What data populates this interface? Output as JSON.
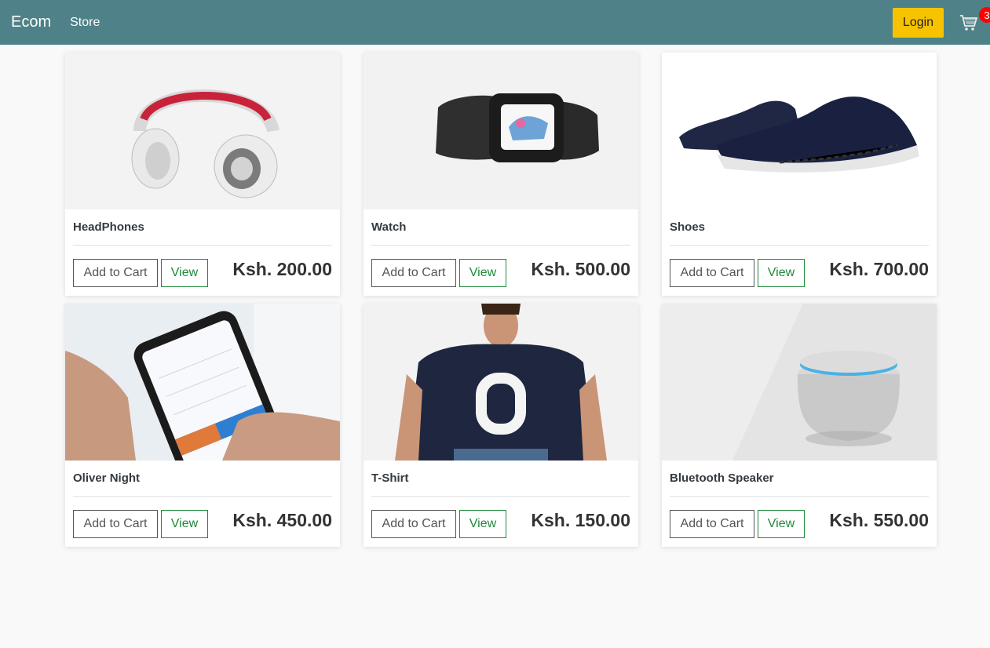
{
  "nav": {
    "brand": "Ecom",
    "store_label": "Store",
    "login_label": "Login",
    "cart_count": "3"
  },
  "products": [
    {
      "name": "HeadPhones",
      "price": "Ksh. 200.00",
      "add_label": "Add to Cart",
      "view_label": "View",
      "image": "headphones"
    },
    {
      "name": "Watch",
      "price": "Ksh. 500.00",
      "add_label": "Add to Cart",
      "view_label": "View",
      "image": "watch"
    },
    {
      "name": "Shoes",
      "price": "Ksh. 700.00",
      "add_label": "Add to Cart",
      "view_label": "View",
      "image": "shoes"
    },
    {
      "name": "Oliver Night",
      "price": "Ksh. 450.00",
      "add_label": "Add to Cart",
      "view_label": "View",
      "image": "phone"
    },
    {
      "name": "T-Shirt",
      "price": "Ksh. 150.00",
      "add_label": "Add to Cart",
      "view_label": "View",
      "image": "tshirt"
    },
    {
      "name": "Bluetooth Speaker",
      "price": "Ksh. 550.00",
      "add_label": "Add to Cart",
      "view_label": "View",
      "image": "speaker"
    }
  ],
  "colors": {
    "navbar": "#4e8288",
    "login": "#f7c300",
    "badge": "#ff0000",
    "view_button": "#1e8a3a"
  }
}
